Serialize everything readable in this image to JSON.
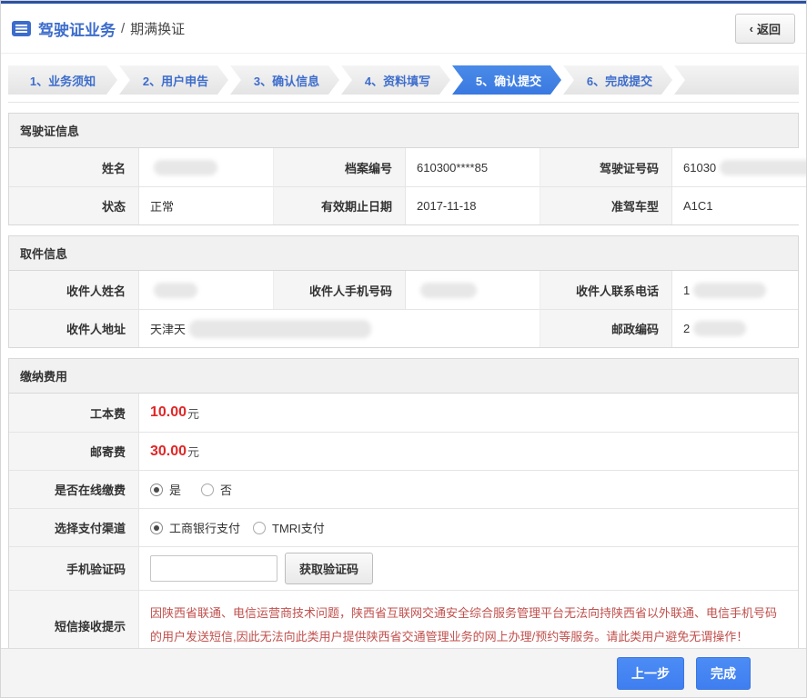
{
  "header": {
    "title": "驾驶证业务",
    "separator": "/",
    "subtitle": "期满换证",
    "back_label": "返回",
    "back_chevron": "‹"
  },
  "icons": {
    "header_icon": "form-list-icon",
    "back_icon": "chevron-left-icon"
  },
  "steps": [
    {
      "label": "1、业务须知",
      "active": false
    },
    {
      "label": "2、用户申告",
      "active": false
    },
    {
      "label": "3、确认信息",
      "active": false
    },
    {
      "label": "4、资料填写",
      "active": false
    },
    {
      "label": "5、确认提交",
      "active": true
    },
    {
      "label": "6、完成提交",
      "active": false
    }
  ],
  "sections": {
    "license": {
      "title": "驾驶证信息",
      "fields": {
        "name": {
          "label": "姓名",
          "value": "",
          "redacted": true
        },
        "file_no": {
          "label": "档案编号",
          "value": "610300****85",
          "redacted": false
        },
        "license_no": {
          "label": "驾驶证号码",
          "value": "61030",
          "redacted": true
        },
        "status": {
          "label": "状态",
          "value": "正常",
          "redacted": false
        },
        "valid_until": {
          "label": "有效期止日期",
          "value": "2017-11-18",
          "redacted": false
        },
        "vehicle_class": {
          "label": "准驾车型",
          "value": "A1C1",
          "redacted": false
        }
      }
    },
    "pickup": {
      "title": "取件信息",
      "fields": {
        "recipient_name": {
          "label": "收件人姓名",
          "value": "",
          "redacted": true
        },
        "recipient_mobile": {
          "label": "收件人手机号码",
          "value": "",
          "redacted": true
        },
        "recipient_phone": {
          "label": "收件人联系电话",
          "value": "1",
          "redacted": true
        },
        "recipient_address": {
          "label": "收件人地址",
          "value": "天津天",
          "redacted": true
        },
        "postal_code": {
          "label": "邮政编码",
          "value": "2",
          "redacted": true
        }
      }
    },
    "payment": {
      "title": "缴纳费用",
      "production_fee": {
        "label": "工本费",
        "amount": "10.00",
        "unit": "元"
      },
      "mailing_fee": {
        "label": "邮寄费",
        "amount": "30.00",
        "unit": "元"
      },
      "online_payment": {
        "label": "是否在线缴费",
        "options": [
          {
            "label": "是",
            "selected": true
          },
          {
            "label": "否",
            "selected": false
          }
        ]
      },
      "channel": {
        "label": "选择支付渠道",
        "options": [
          {
            "label": "工商银行支付",
            "selected": true
          },
          {
            "label": "TMRI支付",
            "selected": false
          }
        ]
      },
      "sms_code": {
        "label": "手机验证码",
        "input_value": "",
        "button_label": "获取验证码"
      },
      "sms_notice": {
        "label": "短信接收提示",
        "text": "因陕西省联通、电信运营商技术问题，陕西省互联网交通安全综合服务管理平台无法向持陕西省以外联通、电信手机号码的用户发送短信,因此无法向此类用户提供陕西省交通管理业务的网上办理/预约等服务。请此类用户避免无谓操作！"
      }
    }
  },
  "footer": {
    "prev_label": "上一步",
    "finish_label": "完成"
  },
  "colors": {
    "top_bar": "#2b52a2",
    "accent_blue": "#3d6dcc",
    "active_step_blue": "#3a79e0",
    "fee_red": "#e02626",
    "notice_red": "#c0504d",
    "button_blue": "#4285f4"
  }
}
